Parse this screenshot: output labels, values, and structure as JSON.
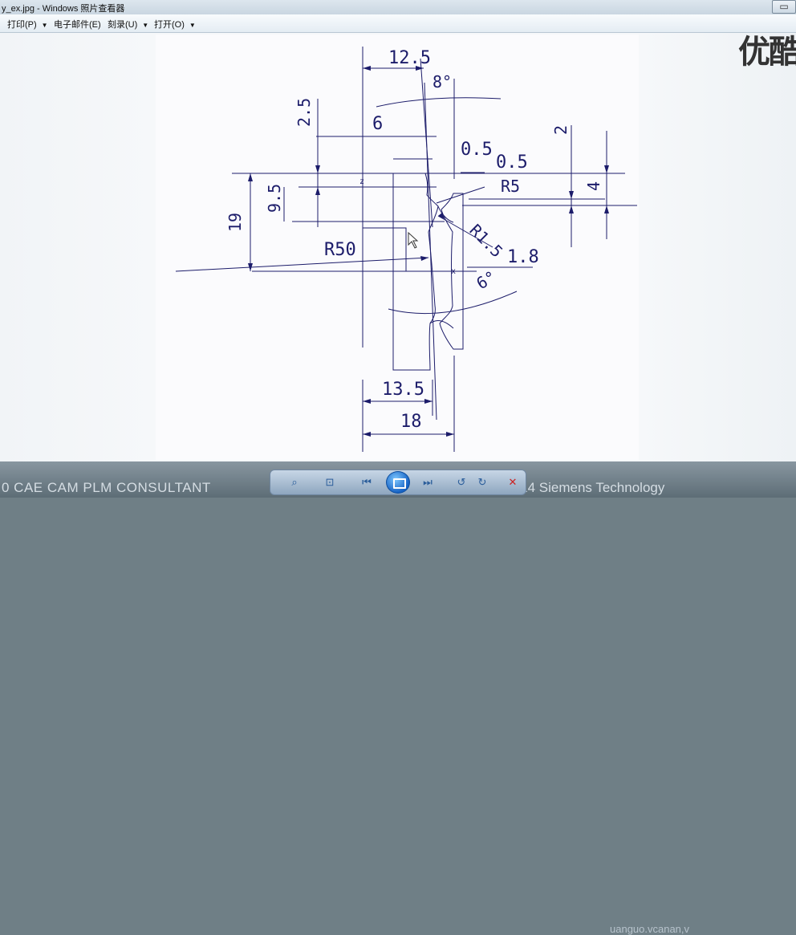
{
  "window": {
    "title": "y_ex.jpg - Windows 照片查看器",
    "min_icon": "minimize-icon",
    "max_icon": "maximize-icon",
    "close_icon": "close-icon"
  },
  "menu": {
    "items": [
      {
        "label": "打印(P)",
        "has_dropdown": true
      },
      {
        "label": "电子邮件(E)",
        "has_dropdown": false
      },
      {
        "label": "刻录(U)",
        "has_dropdown": true
      },
      {
        "label": "打开(O)",
        "has_dropdown": true
      }
    ]
  },
  "background_overlay": {
    "top_right_text": "优酷",
    "bottom_left_text": "0 CAE CAM PLM  CONSULTANT",
    "bottom_right_text": "© 2014 Siemens Technology",
    "bottom_top_text": "uanguo.vcanan,v"
  },
  "drawing": {
    "dimensions": {
      "d_12_5": "12.5",
      "d_8deg": "8°",
      "d_2_5": "2.5",
      "d_6": "6",
      "d_0_5a": "0.5",
      "d_0_5b": "0.5",
      "d_2": "2",
      "d_4": "4",
      "d_R5": "R5",
      "d_19": "19",
      "d_9_5": "9.5",
      "d_R1_5": "R1.5",
      "d_R50": "R50",
      "d_1_8": "1.8",
      "d_6deg": "6°",
      "d_13_5": "13.5",
      "d_18": "18",
      "axis_z": "z",
      "axis_x": "x"
    },
    "line_color": "#1c1c6a"
  },
  "controls": {
    "zoom_icon": "zoom-icon",
    "fit_icon": "actual-size-icon",
    "prev_icon": "previous-icon",
    "slideshow_icon": "slideshow-icon",
    "next_icon": "next-icon",
    "rotate_ccw_icon": "rotate-counterclockwise-icon",
    "rotate_cw_icon": "rotate-clockwise-icon",
    "delete_icon": "delete-icon"
  }
}
